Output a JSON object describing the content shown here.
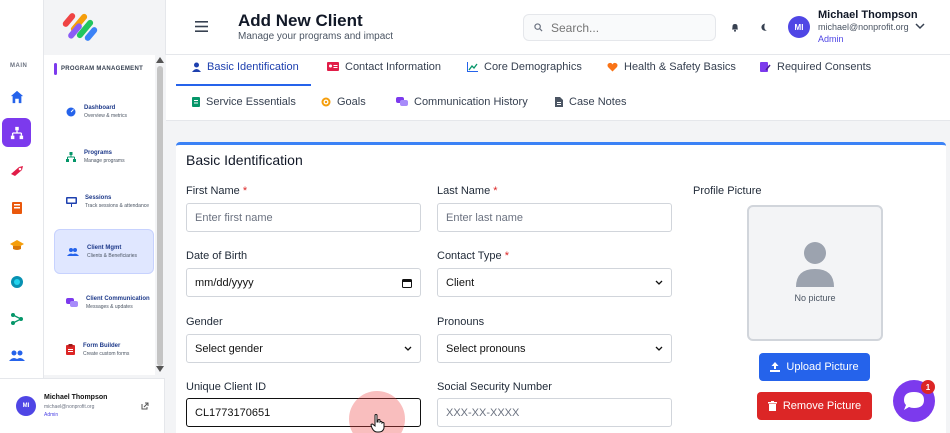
{
  "sidebar": {
    "rail_label": "MAIN",
    "section_label": "PROGRAM MANAGEMENT",
    "items": [
      {
        "title": "Dashboard",
        "subtitle": "Overview & metrics"
      },
      {
        "title": "Programs",
        "subtitle": "Manage programs"
      },
      {
        "title": "Sessions",
        "subtitle": "Track sessions & attendance"
      },
      {
        "title": "Client Mgmt",
        "subtitle": "Clients & Beneficiaries"
      },
      {
        "title": "Client Communication",
        "subtitle": "Messages & updates"
      },
      {
        "title": "Form Builder",
        "subtitle": "Create custom forms"
      }
    ],
    "user": {
      "initials": "MI",
      "name": "Michael Thompson",
      "email": "michael@nonprofit.org",
      "role": "Admin"
    }
  },
  "header": {
    "title": "Add New Client",
    "subtitle": "Manage your programs and impact",
    "search_placeholder": "Search...",
    "user": {
      "initials": "MI",
      "name": "Michael Thompson",
      "email": "michael@nonprofit.org",
      "role": "Admin"
    }
  },
  "tabs": {
    "row1": [
      "Basic Identification",
      "Contact Information",
      "Core Demographics",
      "Health & Safety Basics",
      "Required Consents"
    ],
    "row2": [
      "Service Essentials",
      "Goals",
      "Communication History",
      "Case Notes"
    ],
    "active": "Basic Identification"
  },
  "form": {
    "section_title": "Basic Identification",
    "first_name_label": "First Name",
    "first_name_placeholder": "Enter first name",
    "last_name_label": "Last Name",
    "last_name_placeholder": "Enter last name",
    "dob_label": "Date of Birth",
    "dob_placeholder": "mm/dd/yyyy",
    "contact_type_label": "Contact Type",
    "contact_type_value": "Client",
    "gender_label": "Gender",
    "gender_value": "Select gender",
    "pronouns_label": "Pronouns",
    "pronouns_value": "Select pronouns",
    "client_id_label": "Unique Client ID",
    "client_id_value": "CL1773170651",
    "ssn_label": "Social Security Number",
    "ssn_placeholder": "XXX-XX-XXXX",
    "required_mark": "*",
    "profile_picture_label": "Profile Picture",
    "no_picture_text": "No picture",
    "upload_label": "Upload Picture",
    "remove_label": "Remove Picture"
  },
  "chat": {
    "badge": "1"
  },
  "colors": {
    "primary": "#2563eb",
    "accent": "#7c3aed",
    "danger": "#dc2626"
  }
}
